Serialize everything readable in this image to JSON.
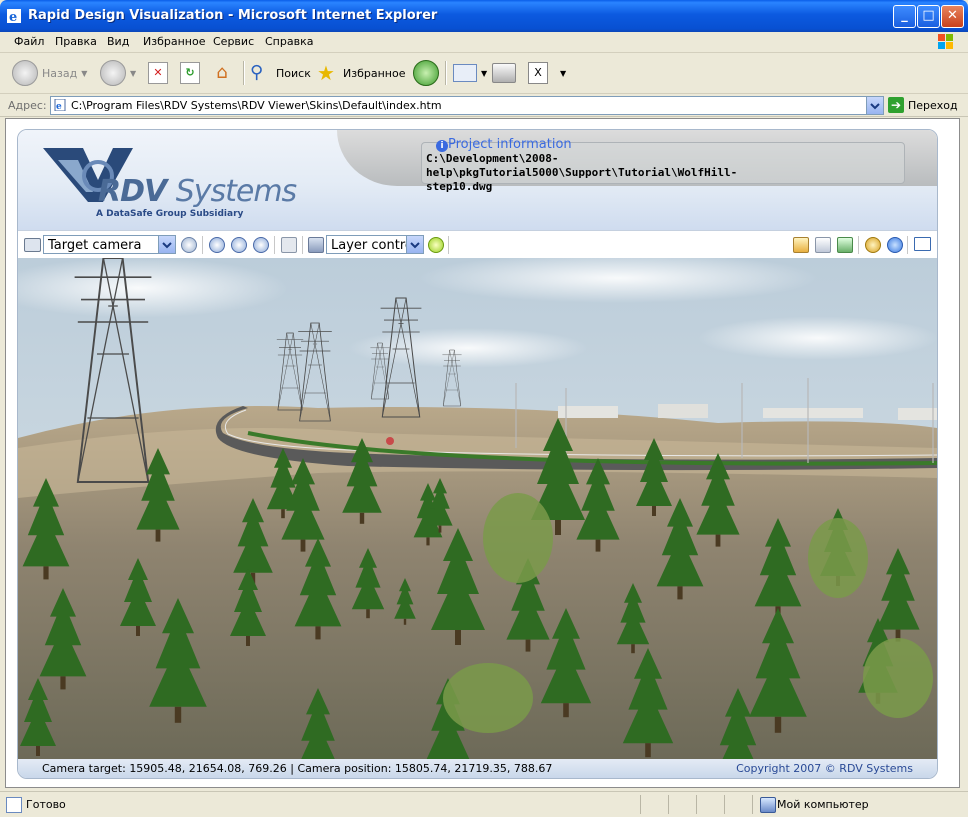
{
  "window": {
    "title": "Rapid Design Visualization - Microsoft Internet Explorer",
    "controls": {
      "minimize": "_",
      "maximize": "□",
      "close": "✕"
    }
  },
  "menu": {
    "items": [
      "Файл",
      "Правка",
      "Вид",
      "Избранное",
      "Сервис",
      "Справка"
    ]
  },
  "toolbar": {
    "back_label": "Назад",
    "search_label": "Поиск",
    "favorites_label": "Избранное"
  },
  "address": {
    "label": "Адрес:",
    "value": "C:\\Program Files\\RDV Systems\\RDV Viewer\\Skins\\Default\\index.htm",
    "go_label": "Переход"
  },
  "app": {
    "logo_brand": "RDV",
    "logo_systems": "Systems",
    "logo_sub": "A DataSafe Group Subsidiary",
    "project_title": "Project information",
    "project_path_line1": "C:\\Development\\2008-help\\pkgTutorial5000\\Support\\Tutorial\\WolfHill-",
    "project_path_line2": "step10.dwg",
    "camera_select": "Target camera",
    "layer_select": "Layer control",
    "camera_status": "Camera target: 15905.48, 21654.08, 769.26 | Camera position: 15805.74, 21719.35, 788.67",
    "copyright": "Copyright 2007 © RDV Systems"
  },
  "statusbar": {
    "left": "Готово",
    "right": "Мой компьютер"
  },
  "colors": {
    "titlebar": "#0c5ae0",
    "accent_link": "#3a6ae0",
    "tree_green": "#2e6a1e",
    "ground": "#8a7f6a",
    "sky": "#c9d9e5"
  }
}
